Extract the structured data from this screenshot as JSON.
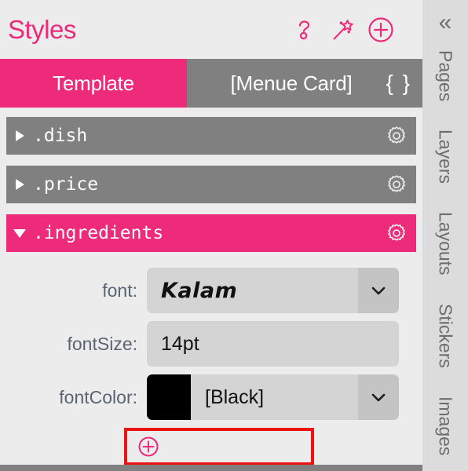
{
  "header": {
    "title": "Styles",
    "icons": [
      {
        "name": "help-icon",
        "glyph": "?"
      },
      {
        "name": "magic-wand-icon",
        "glyph": "wand"
      },
      {
        "name": "add-style-icon",
        "glyph": "+"
      }
    ]
  },
  "tabs": [
    {
      "label": "Template",
      "active": true
    },
    {
      "label": "[Menue Card]",
      "active": false
    }
  ],
  "tab_braces": "{ }",
  "style_rows": [
    {
      "selector": ".dish",
      "expanded": false
    },
    {
      "selector": ".price",
      "expanded": false
    },
    {
      "selector": ".ingredients",
      "expanded": true
    }
  ],
  "properties": [
    {
      "label": "font:",
      "value": "Kalam",
      "has_swatch": false,
      "has_chevron": true,
      "script": true
    },
    {
      "label": "fontSize:",
      "value": "14pt",
      "has_swatch": false,
      "has_chevron": false,
      "script": false
    },
    {
      "label": "fontColor:",
      "value": "[Black]",
      "has_swatch": true,
      "swatch_color": "#000000",
      "has_chevron": true,
      "script": false
    }
  ],
  "add_property": {
    "label": "+",
    "highlight_color": "#ee1111"
  },
  "sidebar": {
    "collapse_label": "«",
    "items": [
      {
        "label": "Pages"
      },
      {
        "label": "Layers"
      },
      {
        "label": "Layouts"
      },
      {
        "label": "Stickers"
      },
      {
        "label": "Images"
      }
    ]
  },
  "colors": {
    "accent_pink": "#ee2a7b",
    "row_gray": "#808080",
    "panel_bg": "#ececec",
    "field_bg": "#d4d4d4",
    "sidebar_bg": "#dcdcdc",
    "label_text": "#5a6472",
    "annotation_red": "#ee1111"
  }
}
